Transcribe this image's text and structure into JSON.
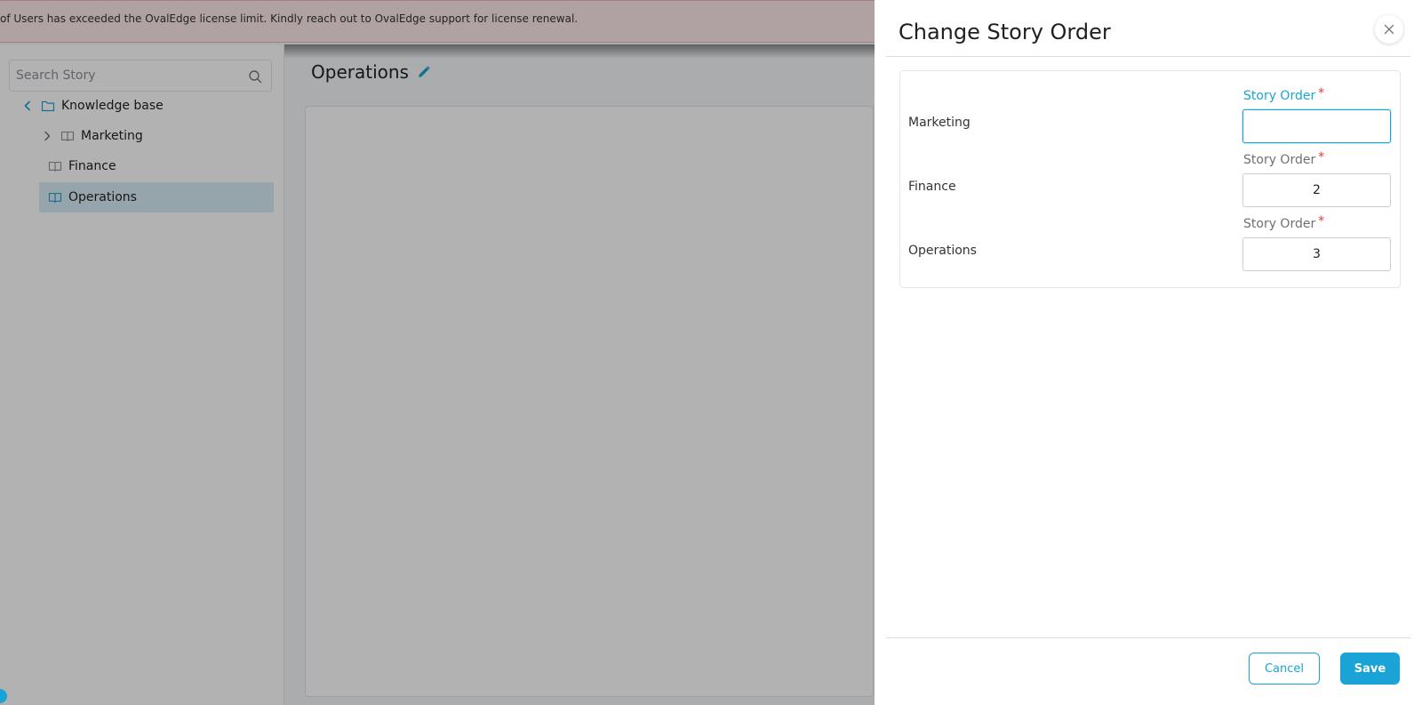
{
  "banner": {
    "message": "of Users has exceeded the OvalEdge license limit. Kindly reach out to OvalEdge support for license renewal."
  },
  "sidebar": {
    "search_placeholder": "Search Story",
    "tree": {
      "root_label": "Knowledge base",
      "children": [
        {
          "label": "Marketing",
          "expandable": true
        },
        {
          "label": "Finance",
          "expandable": false
        },
        {
          "label": "Operations",
          "expandable": false,
          "selected": true
        }
      ]
    }
  },
  "main": {
    "title": "Operations"
  },
  "dialog": {
    "title": "Change Story Order",
    "field_label": "Story Order",
    "required_mark": "*",
    "rows": [
      {
        "name": "Marketing",
        "order": "",
        "focused": true
      },
      {
        "name": "Finance",
        "order": "2",
        "focused": false
      },
      {
        "name": "Operations",
        "order": "3",
        "focused": false
      }
    ],
    "cancel_label": "Cancel",
    "save_label": "Save"
  },
  "colors": {
    "accent": "#1aa3d6",
    "required": "#e53935",
    "banner_bg": "#fde8e8",
    "selected_bg": "#d6ecf5"
  }
}
